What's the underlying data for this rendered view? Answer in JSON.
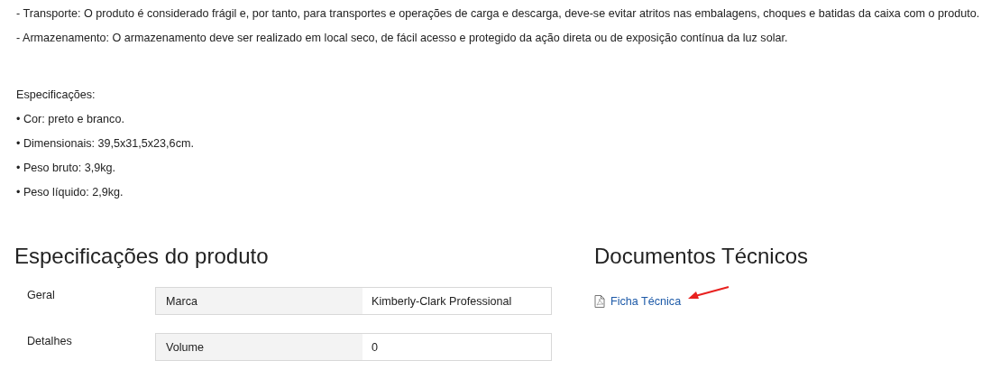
{
  "description": {
    "paragraphs": [
      "- Transporte: O produto é considerado frágil e, por tanto, para transportes e operações de carga e descarga, deve-se evitar atritos nas embalagens, choques e batidas da caixa com o produto.",
      "- Armazenamento: O armazenamento deve ser realizado em local seco, de fácil acesso e protegido da ação direta ou de exposição contínua da luz solar."
    ],
    "specs_heading": "Especificações:",
    "bullets": [
      "• Cor: preto e branco.",
      "• Dimensionais: 39,5x31,5x23,6cm.",
      "• Peso bruto: 3,9kg.",
      "• Peso líquido: 2,9kg."
    ]
  },
  "product_specs": {
    "title": "Especificações do produto",
    "groups": [
      {
        "label": "Geral",
        "rows": [
          {
            "key": "Marca",
            "value": "Kimberly-Clark Professional"
          }
        ]
      },
      {
        "label": "Detalhes",
        "rows": [
          {
            "key": "Volume",
            "value": "0"
          }
        ]
      }
    ]
  },
  "documents": {
    "title": "Documentos Técnicos",
    "links": [
      {
        "label": "Ficha Técnica",
        "annotated": true
      }
    ]
  }
}
